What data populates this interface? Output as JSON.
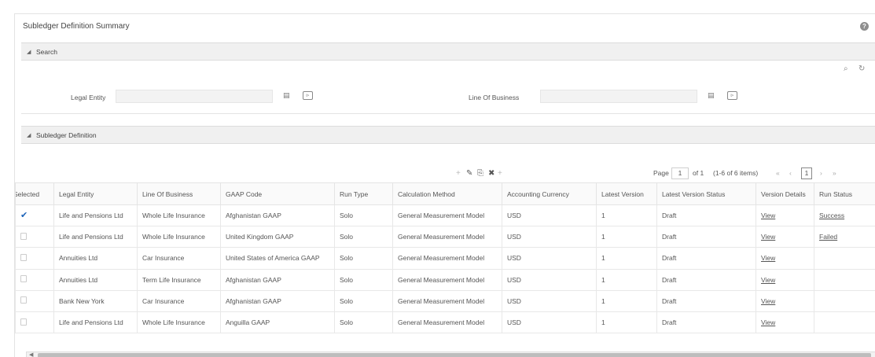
{
  "page": {
    "title": "Subledger Definition Summary",
    "help_icon": "?"
  },
  "search": {
    "section_label": "Search",
    "legal_entity": {
      "label": "Legal Entity",
      "value": ""
    },
    "line_of_business": {
      "label": "Line Of Business",
      "value": ""
    }
  },
  "definition": {
    "section_label": "Subledger Definition",
    "pager": {
      "page_label": "Page",
      "page_value": "1",
      "of_label": "of 1",
      "items_label": "(1-6 of 6 items)",
      "current_page": "1"
    },
    "columns": [
      "Selected",
      "Legal Entity",
      "Line Of Business",
      "GAAP Code",
      "Run Type",
      "Calculation Method",
      "Accounting Currency",
      "Latest Version",
      "Latest Version Status",
      "Version Details",
      "Run Status"
    ],
    "rows": [
      {
        "selected": true,
        "legal_entity": "Life and Pensions Ltd",
        "lob": "Whole Life Insurance",
        "gaap": "Afghanistan GAAP",
        "run_type": "Solo",
        "calc": "General Measurement Model",
        "currency": "USD",
        "version": "1",
        "status": "Draft",
        "details": "View",
        "run_status": "Success"
      },
      {
        "selected": false,
        "legal_entity": "Life and Pensions Ltd",
        "lob": "Whole Life Insurance",
        "gaap": "United Kingdom GAAP",
        "run_type": "Solo",
        "calc": "General Measurement Model",
        "currency": "USD",
        "version": "1",
        "status": "Draft",
        "details": "View",
        "run_status": "Failed"
      },
      {
        "selected": false,
        "legal_entity": "Annuities Ltd",
        "lob": "Car Insurance",
        "gaap": "United States of America GAAP",
        "run_type": "Solo",
        "calc": "General Measurement Model",
        "currency": "USD",
        "version": "1",
        "status": "Draft",
        "details": "View",
        "run_status": ""
      },
      {
        "selected": false,
        "legal_entity": "Annuities Ltd",
        "lob": "Term Life Insurance",
        "gaap": "Afghanistan GAAP",
        "run_type": "Solo",
        "calc": "General Measurement Model",
        "currency": "USD",
        "version": "1",
        "status": "Draft",
        "details": "View",
        "run_status": ""
      },
      {
        "selected": false,
        "legal_entity": "Bank New York",
        "lob": "Car Insurance",
        "gaap": "Afghanistan GAAP",
        "run_type": "Solo",
        "calc": "General Measurement Model",
        "currency": "USD",
        "version": "1",
        "status": "Draft",
        "details": "View",
        "run_status": ""
      },
      {
        "selected": false,
        "legal_entity": "Life and Pensions Ltd",
        "lob": "Whole Life Insurance",
        "gaap": "Anguilla GAAP",
        "run_type": "Solo",
        "calc": "General Measurement Model",
        "currency": "USD",
        "version": "1",
        "status": "Draft",
        "details": "View",
        "run_status": ""
      }
    ]
  }
}
